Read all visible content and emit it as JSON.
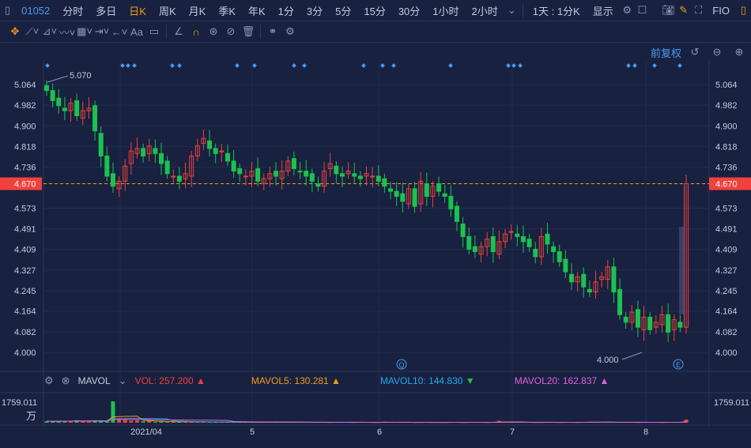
{
  "toolbar": {
    "code": "01052",
    "items": [
      "分时",
      "多日",
      "日K",
      "周K",
      "月K",
      "季K",
      "年K",
      "1分",
      "3分",
      "5分",
      "15分",
      "30分",
      "1小时",
      "2小时"
    ],
    "active": "日K",
    "period": "1天 : 1分K",
    "display": "显示",
    "fio": "FIO"
  },
  "drawing_tools": [
    "move-icon",
    "line-icon",
    "polyline-icon",
    "wave-icon",
    "fib-icon",
    "measure-icon",
    "arrow-icon",
    "text-icon",
    "comment-icon",
    "angle-icon",
    "magnet-icon",
    "lock-icon",
    "hide-icon",
    "delete-icon",
    "compare-icon",
    "settings-icon"
  ],
  "text_tool": "Aa",
  "info": {
    "adjust": "前复权"
  },
  "price_axis": {
    "ticks": [
      "5.064",
      "4.982",
      "4.900",
      "4.818",
      "4.736",
      "4.670",
      "4.573",
      "4.491",
      "4.409",
      "4.327",
      "4.245",
      "4.164",
      "4.082",
      "4.000"
    ],
    "current": "4.670",
    "current_value": 4.67,
    "high_label": "5.070",
    "low_label": "4.000",
    "min": 4.0,
    "max": 5.064
  },
  "date_axis": [
    "2021/04",
    "5",
    "6",
    "7",
    "8"
  ],
  "markers": {
    "q": "Q",
    "e": "E"
  },
  "volume": {
    "indicator": "MAVOL",
    "vol": "VOL: 257.200",
    "ma5": "MAVOL5: 130.281",
    "ma10": "MAVOL10: 144.830",
    "ma20": "MAVOL20: 162.837",
    "axis_max": "1759.011",
    "unit": "万",
    "max": 1759.011
  },
  "colors": {
    "up": "#f0413c",
    "down": "#1cc24f",
    "accent": "#f39a1c",
    "blue": "#4c9cf0",
    "ma5": "#f39a1c",
    "ma10": "#27a9f0",
    "ma20": "#e060e0"
  },
  "chart_data": {
    "type": "candlestick",
    "close": [
      5.04,
      5.0,
      4.98,
      4.96,
      4.99,
      4.94,
      4.96,
      4.97,
      4.88,
      4.78,
      4.7,
      4.66,
      4.68,
      4.74,
      4.8,
      4.81,
      4.78,
      4.82,
      4.79,
      4.75,
      4.71,
      4.7,
      4.68,
      4.71,
      4.78,
      4.82,
      4.85,
      4.81,
      4.79,
      4.8,
      4.76,
      4.72,
      4.71,
      4.7,
      4.72,
      4.68,
      4.69,
      4.71,
      4.7,
      4.72,
      4.76,
      4.73,
      4.72,
      4.7,
      4.68,
      4.66,
      4.72,
      4.75,
      4.71,
      4.7,
      4.72,
      4.7,
      4.69,
      4.71,
      4.7,
      4.68,
      4.66,
      4.64,
      4.62,
      4.6,
      4.65,
      4.58,
      4.68,
      4.62,
      4.66,
      4.64,
      4.62,
      4.57,
      4.52,
      4.46,
      4.41,
      4.4,
      4.42,
      4.45,
      4.4,
      4.44,
      4.47,
      4.48,
      4.46,
      4.44,
      4.42,
      4.38,
      4.46,
      4.43,
      4.4,
      4.36,
      4.32,
      4.28,
      4.3,
      4.26,
      4.24,
      4.28,
      4.3,
      4.34,
      4.24,
      4.15,
      4.12,
      4.16,
      4.1,
      4.14,
      4.09,
      4.12,
      4.15,
      4.08,
      4.13,
      4.1,
      4.67
    ],
    "volume": [
      120,
      140,
      110,
      160,
      130,
      200,
      110,
      150,
      180,
      140,
      160,
      1759,
      300,
      250,
      180,
      200,
      120,
      150,
      60,
      90,
      70,
      80,
      60,
      90,
      70,
      50,
      60,
      40,
      70,
      60,
      50,
      30,
      40,
      60,
      50,
      40,
      50,
      30,
      60,
      40,
      30,
      50,
      40,
      20,
      30,
      40,
      30,
      20,
      30,
      40,
      30,
      20,
      30,
      40,
      20,
      30,
      80,
      20,
      30,
      40,
      20,
      30,
      20,
      40,
      30,
      20,
      30,
      40,
      30,
      20,
      30,
      40,
      30,
      20,
      30,
      150,
      40,
      30,
      20,
      30,
      40,
      20,
      30,
      40,
      20,
      30,
      40,
      30,
      20,
      30,
      70,
      60,
      40,
      30,
      20,
      30,
      40,
      30,
      20,
      30,
      40,
      30,
      20,
      30,
      40,
      30,
      257
    ]
  }
}
